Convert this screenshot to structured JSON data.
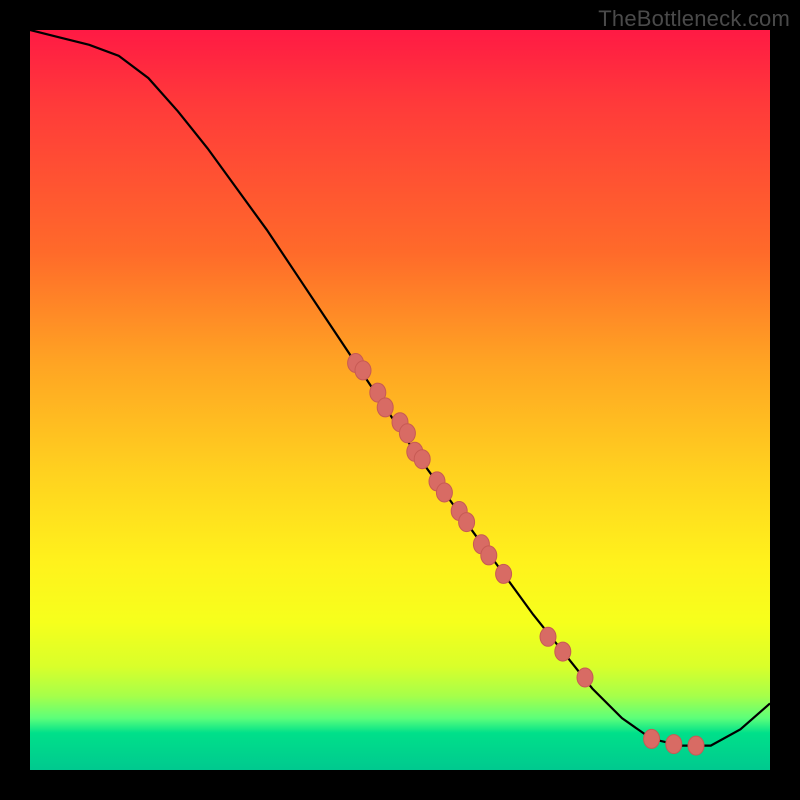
{
  "watermark": "TheBottleneck.com",
  "colors": {
    "curve": "#000000",
    "marker_fill": "#d86b64",
    "marker_stroke": "#c75a54",
    "frame": "#000000"
  },
  "chart_data": {
    "type": "line",
    "title": "",
    "xlabel": "",
    "ylabel": "",
    "xlim": [
      0,
      100
    ],
    "ylim": [
      0,
      100
    ],
    "grid": false,
    "legend": false,
    "series": [
      {
        "name": "bottleneck-curve",
        "x": [
          0,
          4,
          8,
          12,
          16,
          20,
          24,
          28,
          32,
          36,
          40,
          44,
          48,
          52,
          56,
          60,
          64,
          68,
          72,
          76,
          80,
          84,
          88,
          92,
          96,
          100
        ],
        "y": [
          100,
          99,
          98,
          96.5,
          93.5,
          89,
          84,
          78.5,
          73,
          67,
          61,
          55,
          49,
          43,
          37.5,
          32,
          26.5,
          21,
          16,
          11,
          7,
          4.2,
          3.3,
          3.3,
          5.5,
          9
        ]
      }
    ],
    "markers": {
      "name": "highlighted-points",
      "x": [
        44,
        45,
        47,
        48,
        50,
        51,
        52,
        53,
        55,
        56,
        58,
        59,
        61,
        62,
        64,
        70,
        72,
        75,
        84,
        87,
        90
      ],
      "y": [
        55,
        54,
        51,
        49,
        47,
        45.5,
        43,
        42,
        39,
        37.5,
        35,
        33.5,
        30.5,
        29,
        26.5,
        18,
        16,
        12.5,
        4.2,
        3.5,
        3.3
      ]
    }
  }
}
